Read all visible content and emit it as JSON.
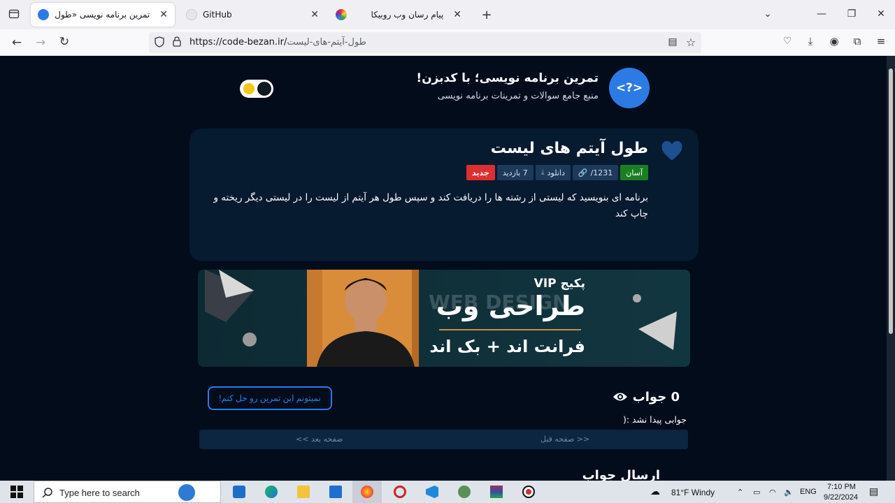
{
  "browser": {
    "tabs": [
      {
        "title": "تمرین برنامه نویسی «طول آیتم ه",
        "active": true
      },
      {
        "title": "GitHub",
        "active": false
      },
      {
        "title": "پیام رسان وب روبیکا",
        "active": false
      }
    ],
    "url_host": "https://code-bezan.ir/",
    "url_path": "طول-آیتم-های-لیست"
  },
  "site": {
    "logo_text": "<?>",
    "title": "تمرین برنامه نویسی؛ با کدبزن!",
    "subtitle": "منبع جامع سوالات و تمرینات برنامه نویسی"
  },
  "question": {
    "title": "طول آیتم های لیست",
    "badges": {
      "difficulty": "آسان",
      "id": "1231/",
      "download": "دانلود",
      "views": "7 بازدید",
      "new": "جدید"
    },
    "description": "برنامه ای بنویسید که لیستی از رشته ها را دریافت کند و سپس طول هر آیتم از لیست را در لیستی دیگر ریخته و چاپ کند"
  },
  "banner": {
    "top_label": "پکیج VIP",
    "ghost_text": "WEB DESIGN",
    "main_text": "طراحی وب",
    "sub_text": "فرانت اند + بک اند"
  },
  "answers": {
    "heading": "0 جواب",
    "empty": "جوابی پیدا نشد :(",
    "cant_solve": "نمیتونم این تمرین رو حل کنم!",
    "prev": "<< صفحه قبل",
    "next": "صفحه بعد >>",
    "send_heading": "ارسال جواب"
  },
  "taskbar": {
    "search_placeholder": "Type here to search",
    "weather": "81°F  Windy",
    "lang": "ENG",
    "time": "7:10 PM",
    "date": "9/22/2024"
  },
  "colors": {
    "page_bg": "#020c1b",
    "card_bg": "#061a30",
    "accent": "#2c7be5",
    "easy": "#1a7f22",
    "new": "#dc2f2f"
  }
}
